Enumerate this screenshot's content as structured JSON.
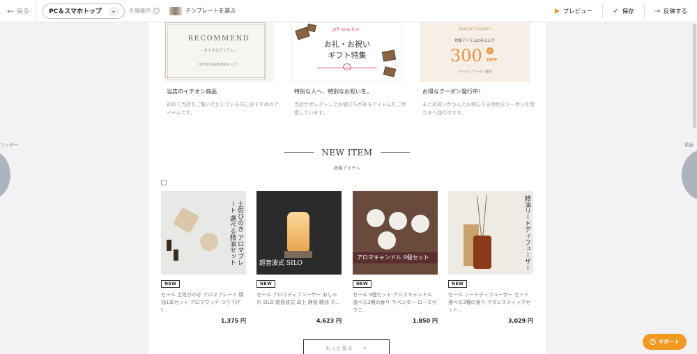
{
  "toolbar": {
    "back_label": "戻る",
    "device_select": "PC＆スマホトップ",
    "editing_label": "を編集中",
    "template_label": "テンプレートを選ぶ",
    "preview_label": "プレビュー",
    "save_label": "保存",
    "publish_label": "反映する"
  },
  "side": {
    "left_label": "フッター",
    "right_label": "看板"
  },
  "banners": [
    {
      "title": "当店のイチオシ商品",
      "desc": "初めて当店をご覧いただいている方におすすめのアイテムです。",
      "img_heading": "RECOMMEND",
      "img_sub": "- おすすめアイテム -",
      "img_note": "今が旬な商品を集めました！"
    },
    {
      "title": "特別な人へ、特別なお祝いを。",
      "desc": "当店がセレクトしたお値打ちがあるアイテムをご用意しています。",
      "img_tag": "gift selection",
      "img_line1": "お礼・お祝い",
      "img_line2": "ギフト特集"
    },
    {
      "title": "お得なクーポン発行中！",
      "desc": "まとめ買いがうんとお得になる特別なクーポンを皆さまへ発行中です。",
      "img_script": "Special Coupon",
      "img_sub": "対象アイテム2点以上で",
      "img_amount": "300",
      "img_yen": "円",
      "img_off": "OFF",
      "img_note": "クリックしてクーポン獲得"
    }
  ],
  "new_item": {
    "title": "NEW ITEM",
    "subtitle": "新着アイテム",
    "more_label": "もっと見る",
    "more_arrow": ">"
  },
  "products": [
    {
      "badge": "NEW",
      "name": "セール 土佐ひのき アロマプレート 精油1本セット アロマウッド つり下げ f...",
      "price": "1,375",
      "currency": "円",
      "img_text": "土佐ひのき アロマプレート 選べる精油セット"
    },
    {
      "badge": "NEW",
      "name": "セール アロマディフューザー おしゃれ SILO 超音波式 卓上 静音 精油 タ...",
      "price": "4,623",
      "currency": "円",
      "img_text": "超音波式 SILO"
    },
    {
      "badge": "NEW",
      "name": "セール 9個セット アロマキャンドル 選べる3種の香り ラベンダー ローズゼラニ...",
      "price": "1,850",
      "currency": "円",
      "img_text": "アロマキャンドル 9個セット"
    },
    {
      "badge": "NEW",
      "name": "セール リードディフューザー セット 選べる3種の香り ラタンスティックセット...",
      "price": "3,029",
      "currency": "円",
      "img_text": "精油リードディフューザー"
    }
  ],
  "support": {
    "label": "サポート"
  },
  "colors": {
    "accent": "#f29a1f",
    "save": "#2f5f9e"
  }
}
